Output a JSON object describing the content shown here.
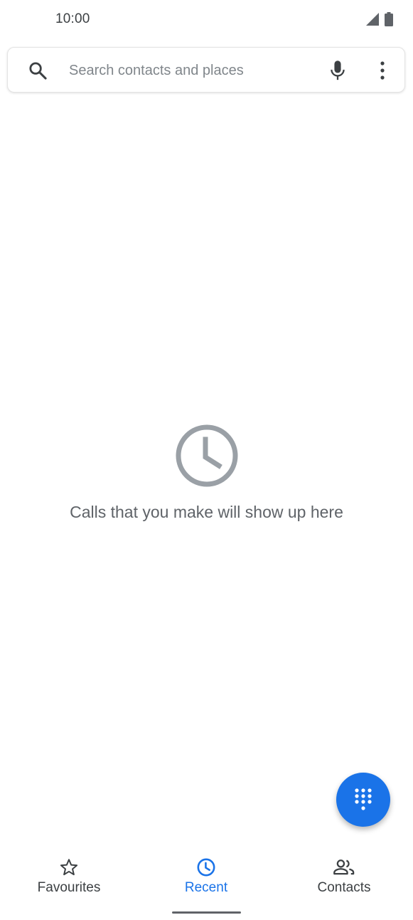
{
  "status_bar": {
    "time": "10:00",
    "icons": [
      "signal-icon",
      "battery-icon"
    ]
  },
  "search": {
    "placeholder": "Search contacts and places",
    "value": "",
    "icons": [
      "search-icon",
      "mic-icon",
      "more-vert-icon"
    ]
  },
  "empty_state": {
    "icon": "clock-icon",
    "message": "Calls that you make will show up here"
  },
  "fab": {
    "icon": "dialpad-icon",
    "color": "#1a73e8"
  },
  "bottom_nav": {
    "items": [
      {
        "label": "Favourites",
        "icon": "star-outline-icon",
        "active": false
      },
      {
        "label": "Recent",
        "icon": "clock-icon",
        "active": true
      },
      {
        "label": "Contacts",
        "icon": "people-icon",
        "active": false
      }
    ],
    "active_color": "#1a73e8",
    "inactive_color": "#3c4043"
  }
}
